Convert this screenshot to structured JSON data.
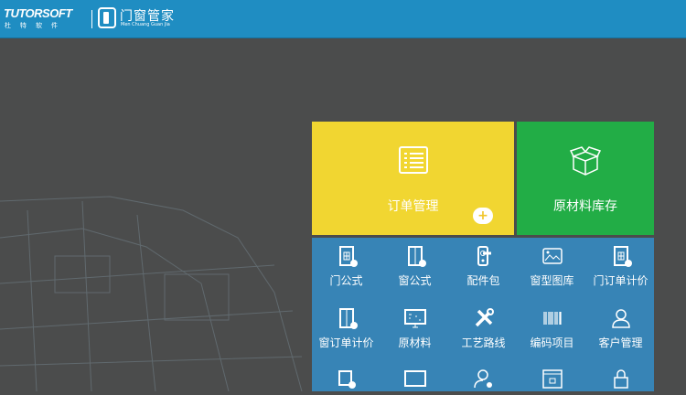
{
  "header": {
    "brand": "TUTORSOFT",
    "brand_sub": "杜特软件",
    "app_name": "门窗管家",
    "app_name_en": "Men Chuang Guan Jia"
  },
  "tiles": [
    {
      "label": "订单管理",
      "icon": "list-icon"
    },
    {
      "label": "原材料库存",
      "icon": "box-icon"
    }
  ],
  "add_label": "+",
  "menu": [
    {
      "label": "门公式",
      "icon": "door-formula-icon"
    },
    {
      "label": "窗公式",
      "icon": "window-formula-icon"
    },
    {
      "label": "配件包",
      "icon": "door-handle-icon"
    },
    {
      "label": "窗型图库",
      "icon": "image-icon"
    },
    {
      "label": "门订单计价",
      "icon": "door-add-icon"
    },
    {
      "label": "窗订单计价",
      "icon": "window-add-icon"
    },
    {
      "label": "原材料",
      "icon": "monitor-icon"
    },
    {
      "label": "工艺路线",
      "icon": "tools-icon"
    },
    {
      "label": "编码项目",
      "icon": "barcode-icon"
    },
    {
      "label": "客户管理",
      "icon": "user-icon"
    },
    {
      "label": "",
      "icon": "document-check-icon"
    },
    {
      "label": "",
      "icon": "screen-icon"
    },
    {
      "label": "",
      "icon": "user-settings-icon"
    },
    {
      "label": "",
      "icon": "browser-lock-icon"
    },
    {
      "label": "",
      "icon": "lock-icon"
    }
  ],
  "colors": {
    "header": "#1f8dc2",
    "yellow": "#f1d631",
    "green": "#22ad46",
    "panel": "#3784b6",
    "background": "#4b4c4c"
  }
}
